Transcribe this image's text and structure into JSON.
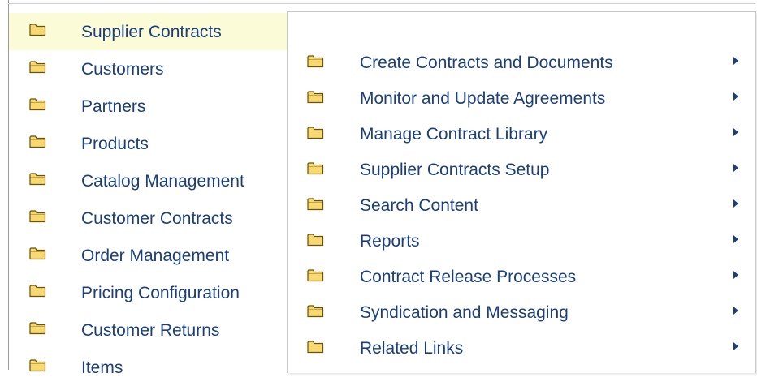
{
  "left_menu": {
    "items": [
      {
        "label": "Supplier Contracts",
        "icon": "folder-icon",
        "selected": true
      },
      {
        "label": "Customers",
        "icon": "folder-icon"
      },
      {
        "label": "Partners",
        "icon": "folder-icon"
      },
      {
        "label": "Products",
        "icon": "folder-icon"
      },
      {
        "label": "Catalog Management",
        "icon": "folder-icon"
      },
      {
        "label": "Customer Contracts",
        "icon": "folder-icon"
      },
      {
        "label": "Order Management",
        "icon": "folder-icon"
      },
      {
        "label": "Pricing Configuration",
        "icon": "folder-icon"
      },
      {
        "label": "Customer Returns",
        "icon": "folder-icon"
      },
      {
        "label": "Items",
        "icon": "folder-icon"
      }
    ]
  },
  "submenu": {
    "items": [
      {
        "label": "Create Contracts and Documents",
        "icon": "folder-icon",
        "has_submenu": true
      },
      {
        "label": "Monitor and Update Agreements",
        "icon": "folder-icon",
        "has_submenu": true
      },
      {
        "label": "Manage Contract Library",
        "icon": "folder-icon",
        "has_submenu": true
      },
      {
        "label": "Supplier Contracts Setup",
        "icon": "folder-icon",
        "has_submenu": true
      },
      {
        "label": "Search Content",
        "icon": "folder-icon",
        "has_submenu": true
      },
      {
        "label": "Reports",
        "icon": "folder-icon",
        "has_submenu": true
      },
      {
        "label": "Contract Release Processes",
        "icon": "folder-icon",
        "has_submenu": true
      },
      {
        "label": "Syndication and Messaging",
        "icon": "folder-icon",
        "has_submenu": true
      },
      {
        "label": "Related Links",
        "icon": "folder-icon",
        "has_submenu": true
      }
    ]
  },
  "colors": {
    "link": "#1b3f7c",
    "selected_background": "#fbfbd7",
    "folder_fill": "#f7d871",
    "folder_outline": "#6a5208"
  }
}
